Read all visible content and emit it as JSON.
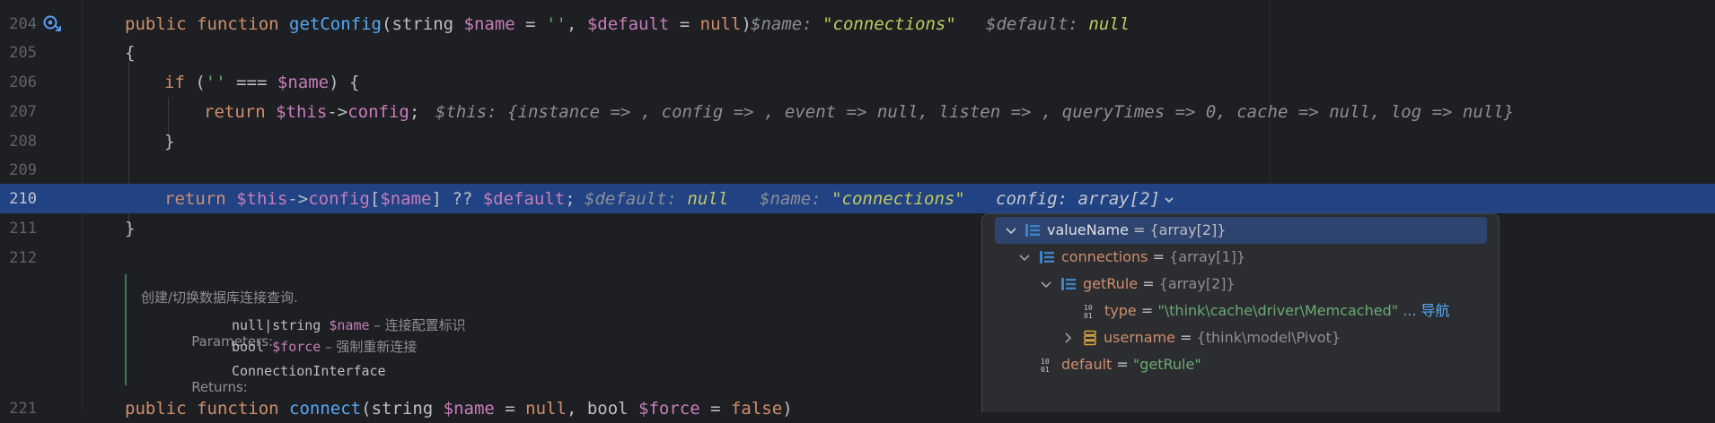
{
  "editor": {
    "lines": {
      "l204": {
        "num": "204",
        "kw": "public function",
        "fn": "getConfig",
        "open": "(string ",
        "p1": "$name",
        "eq1": " = ",
        "s1": "''",
        "comma": ", ",
        "p2": "$default",
        "eq2": " = ",
        "nullkw": "null",
        "close": ")",
        "hint1_name": "$name: ",
        "hint1_val": "\"connections\"",
        "hint2_name": "$default: ",
        "hint2_val": "null"
      },
      "l205": {
        "num": "205",
        "text": "{"
      },
      "l206": {
        "num": "206",
        "kw": "if",
        "open": " (",
        "s": "''",
        "op": " === ",
        "v": "$name",
        "close": ") {"
      },
      "l207": {
        "num": "207",
        "kw": "return",
        "v": "$this",
        "arrow": "->",
        "prop": "config",
        "semi": ";",
        "hint": "$this: {instance => , config => , event => null, listen => , queryTimes => 0, cache => null, log => null}"
      },
      "l208": {
        "num": "208",
        "text": "}"
      },
      "l209": {
        "num": "209"
      },
      "l210": {
        "num": "210",
        "kw": "return",
        "v1": "$this",
        "arrow": "->",
        "prop": "config",
        "br1": "[",
        "v2": "$name",
        "br2": "]",
        "op": " ?? ",
        "v3": "$default",
        "semi": ";",
        "hint1_name": "$default: ",
        "hint1_val": "null",
        "hint2_name": "$name: ",
        "hint2_val": "\"connections\"",
        "hint3": "config: array[2]"
      },
      "l211": {
        "num": "211",
        "text": "}"
      },
      "l212": {
        "num": "212"
      },
      "l221": {
        "num": "221",
        "kw": "public function",
        "fn": "connect",
        "open": "(string ",
        "p1": "$name",
        "eq1": " = ",
        "k1": "null",
        "mid": ", bool ",
        "p2": "$force",
        "eq2": " = ",
        "k2": "false",
        "close": ")"
      }
    }
  },
  "doc": {
    "title": "创建/切换数据库连接查询.",
    "params_label": "Parameters:",
    "param1_type": "null|string ",
    "param1_var": "$name",
    "param1_desc": " – 连接配置标识",
    "param2_type": "bool ",
    "param2_var": "$force",
    "param2_desc": " – 强制重新连接",
    "returns_label": "Returns:",
    "returns_type": "ConnectionInterface"
  },
  "popup": {
    "rows": [
      {
        "name": "valueName",
        "eq": " = ",
        "type": "{array[2]}"
      },
      {
        "name": "connections",
        "eq": " = ",
        "type": "{array[1]}"
      },
      {
        "name": "getRule",
        "eq": " = ",
        "type": "{array[2]}"
      },
      {
        "name": "type",
        "eq": " = ",
        "value": "\"\\think\\cache\\driver\\Memcached\"",
        "link": "... 导航"
      },
      {
        "name": "username",
        "eq": " = ",
        "type": "{think\\model\\Pivot}"
      },
      {
        "name": "default",
        "eq": " = ",
        "value": "\"getRule\""
      }
    ]
  },
  "icons": {
    "gutter": "override-method-icon",
    "array": "array-icon",
    "primitive": "primitive-icon",
    "object": "object-icon",
    "expand": "chevron-down-icon",
    "collapsed": "chevron-right-icon",
    "hint_dropdown": "chevron-down-icon"
  },
  "colors": {
    "background": "#1e1f22",
    "selection": "#214283",
    "keyword": "#cf8e6d",
    "function": "#56a8f5",
    "variable": "#c77dbb",
    "string": "#6aab73",
    "hint_value": "#c4c95d"
  }
}
